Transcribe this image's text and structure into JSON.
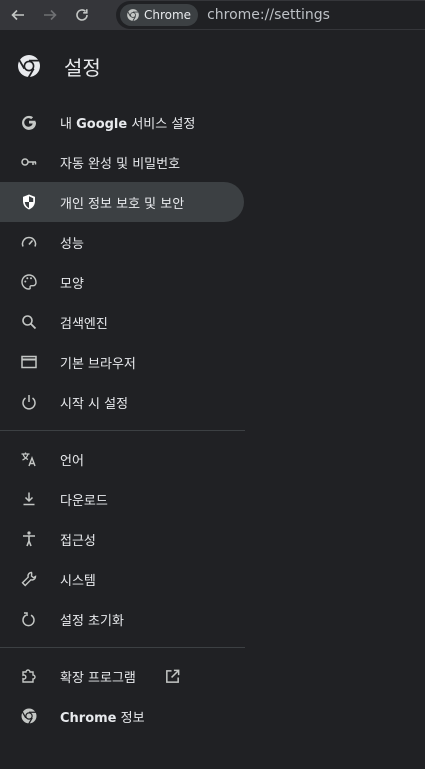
{
  "browser": {
    "chip_label": "Chrome",
    "url": "chrome://settings"
  },
  "settings": {
    "title": "설정"
  },
  "menu": {
    "group1": [
      {
        "label": "내 Google 서비스 설정",
        "icon": "google-icon"
      },
      {
        "label": "자동 완성 및 비밀번호",
        "icon": "key-icon"
      },
      {
        "label": "개인 정보 보호 및 보안",
        "icon": "shield-icon",
        "selected": true
      },
      {
        "label": "성능",
        "icon": "speedometer-icon"
      },
      {
        "label": "모양",
        "icon": "palette-icon"
      },
      {
        "label": "검색엔진",
        "icon": "search-icon"
      },
      {
        "label": "기본 브라우저",
        "icon": "browser-window-icon"
      },
      {
        "label": "시작 시 설정",
        "icon": "power-icon"
      }
    ],
    "group2": [
      {
        "label": "언어",
        "icon": "translate-icon"
      },
      {
        "label": "다운로드",
        "icon": "download-icon"
      },
      {
        "label": "접근성",
        "icon": "accessibility-icon"
      },
      {
        "label": "시스템",
        "icon": "wrench-icon"
      },
      {
        "label": "설정 초기화",
        "icon": "reset-icon"
      }
    ],
    "group3": [
      {
        "label": "확장 프로그램",
        "icon": "puzzle-icon",
        "external": "external-link-icon"
      },
      {
        "label": "Chrome 정보",
        "icon": "chrome-icon"
      }
    ]
  },
  "colors": {
    "background": "#202124",
    "toolbar": "#35363a",
    "selected": "#3c4043",
    "text": "#e8eaed",
    "icon": "#c4c7c5"
  }
}
